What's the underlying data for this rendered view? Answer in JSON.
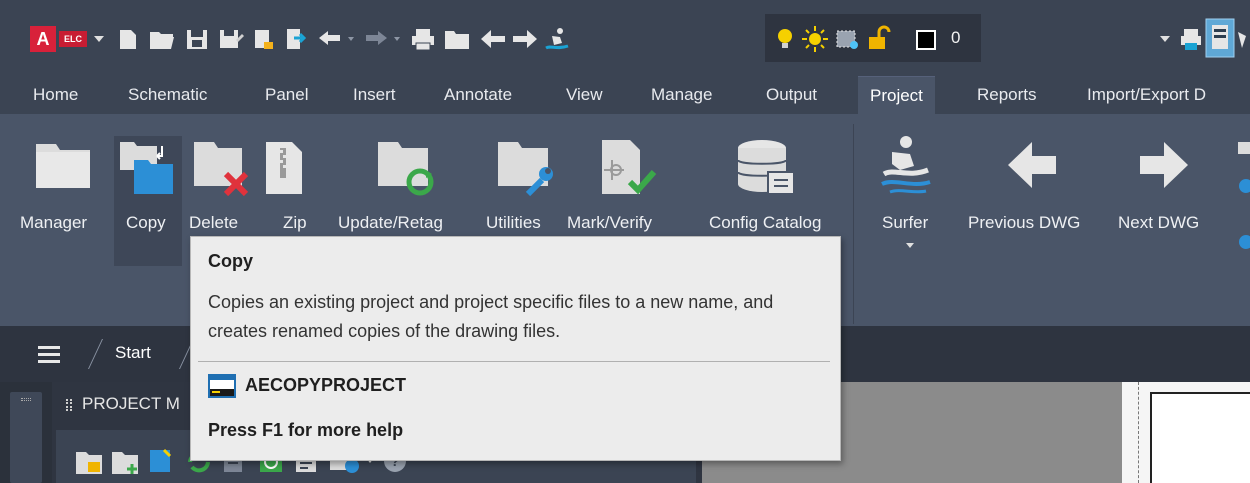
{
  "qat": {
    "logo": "A",
    "product_badge": "ELC",
    "layer_number": "0"
  },
  "tabs": [
    {
      "label": "Home"
    },
    {
      "label": "Schematic"
    },
    {
      "label": "Panel"
    },
    {
      "label": "Insert"
    },
    {
      "label": "Annotate"
    },
    {
      "label": "View"
    },
    {
      "label": "Manage"
    },
    {
      "label": "Output"
    },
    {
      "label": "Project",
      "active": true
    },
    {
      "label": "Reports"
    },
    {
      "label": "Import/Export D"
    }
  ],
  "ribbon": {
    "buttons": [
      {
        "label": "Manager",
        "icon": "folder-icon"
      },
      {
        "label": "Copy",
        "icon": "folder-copy-icon"
      },
      {
        "label": "Delete",
        "icon": "folder-delete-icon"
      },
      {
        "label": "Zip",
        "icon": "zip-icon"
      },
      {
        "label": "Update/Retag",
        "icon": "folder-refresh-icon"
      },
      {
        "label": "Utilities",
        "icon": "folder-wrench-icon"
      },
      {
        "label": "Mark/Verify",
        "icon": "mark-verify-icon"
      },
      {
        "label": "Config Catalog",
        "icon": "database-icon"
      },
      {
        "label": "Surfer",
        "icon": "surfer-icon"
      },
      {
        "label": "Previous DWG",
        "icon": "arrow-left-icon"
      },
      {
        "label": "Next DWG",
        "icon": "arrow-right-icon"
      }
    ]
  },
  "navbar": {
    "start_tab": "Start"
  },
  "project_manager": {
    "header": "PROJECT M"
  },
  "tooltip": {
    "title": "Copy",
    "description": "Copies an existing project and project specific files to a new name, and creates renamed copies of the drawing files.",
    "command": "AECOPYPROJECT",
    "help": "Press F1 for more help"
  },
  "colors": {
    "ribbon_bg": "#4a5568",
    "titlebar_bg": "#3b4453",
    "accent_blue": "#2c8fd6",
    "logo_red": "#d8213a"
  }
}
